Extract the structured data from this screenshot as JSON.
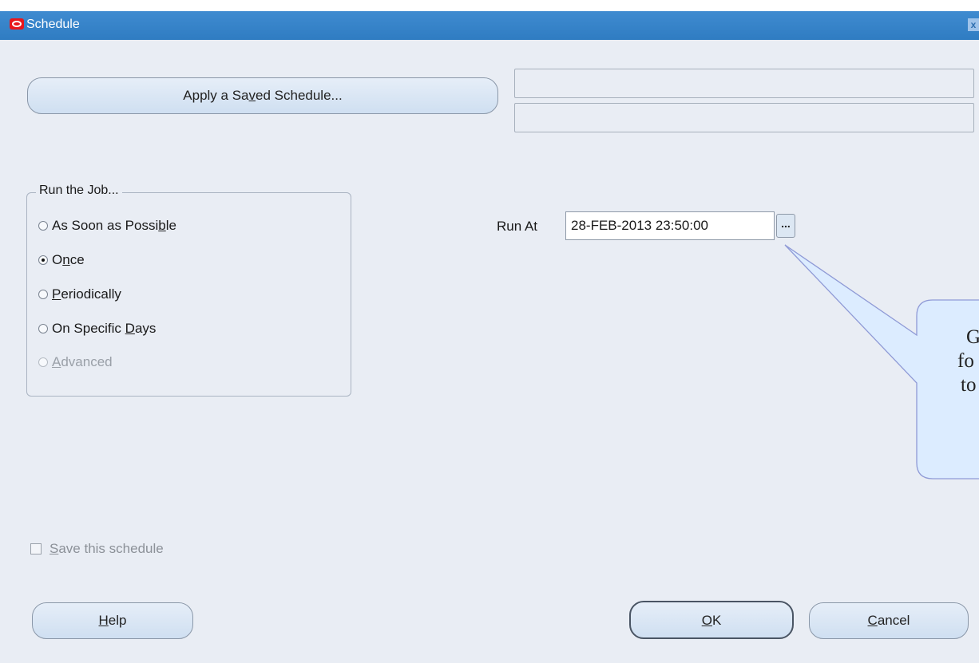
{
  "window": {
    "title": "Schedule",
    "close_glyph": "x"
  },
  "buttons": {
    "apply_saved_schedule": "Apply a Saved Schedule...",
    "help": "Help",
    "ok": "OK",
    "cancel": "Cancel"
  },
  "run_group": {
    "legend": "Run the Job...",
    "options": [
      {
        "label": "As Soon as Possible",
        "checked": false,
        "enabled": true
      },
      {
        "label": "Once",
        "checked": true,
        "enabled": true
      },
      {
        "label": "Periodically",
        "checked": false,
        "enabled": true
      },
      {
        "label": "On Specific Days",
        "checked": false,
        "enabled": true
      },
      {
        "label": "Advanced",
        "checked": false,
        "enabled": false
      }
    ]
  },
  "run_at": {
    "label": "Run At",
    "value": "28-FEB-2013 23:50:00",
    "lov_glyph": "..."
  },
  "callout": {
    "lines": [
      "G",
      "fo",
      "to"
    ]
  },
  "save_schedule": {
    "label": "Save this schedule",
    "checked": false,
    "enabled": false
  },
  "colors": {
    "titlebar": "#2f7cc2",
    "background": "#e9edf4",
    "callout_fill": "#dcecff",
    "callout_stroke": "#8f9ad6"
  },
  "icons": {
    "app": "oracle-logo-icon",
    "close": "close-icon",
    "lov": "ellipsis-icon"
  }
}
